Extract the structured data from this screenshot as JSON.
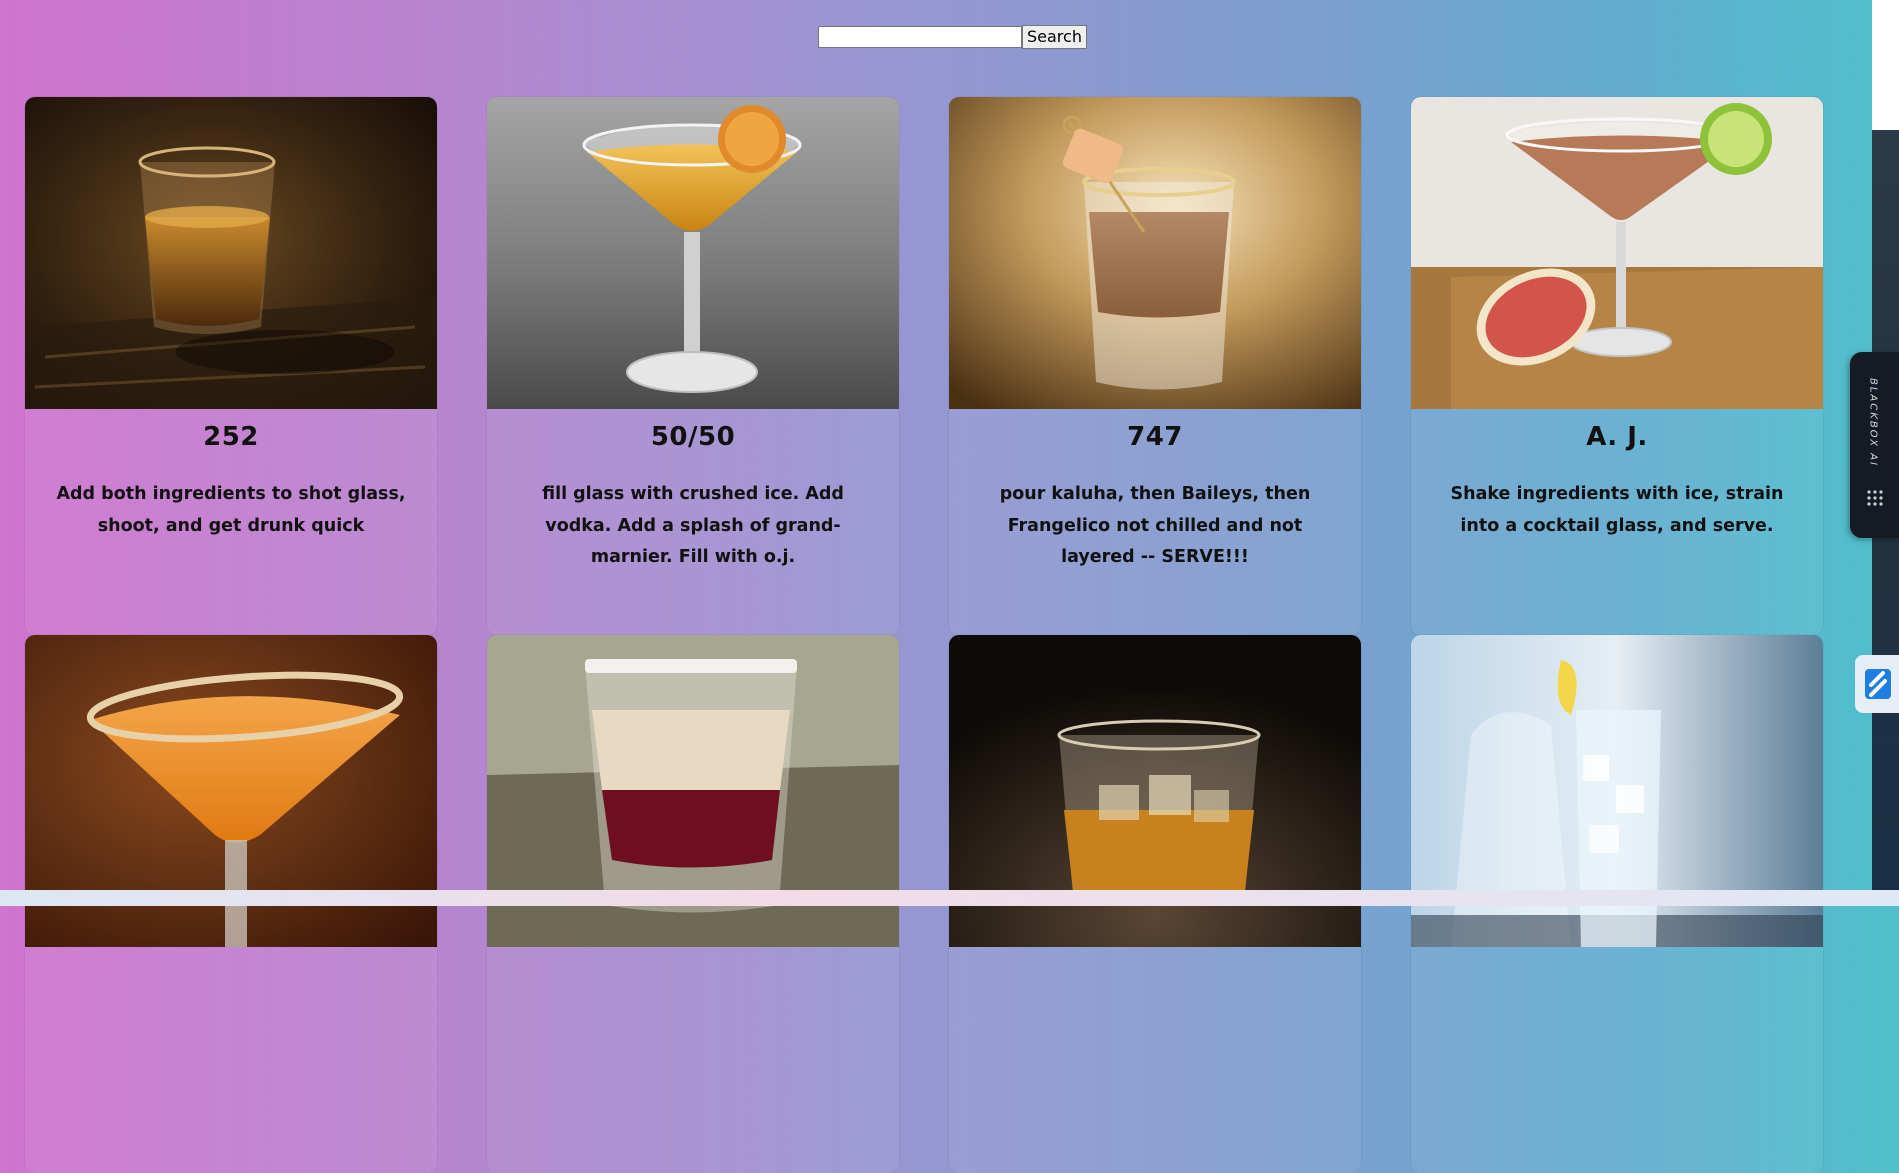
{
  "search": {
    "value": "",
    "placeholder": "",
    "button_label": "Search"
  },
  "cocktails": [
    {
      "name": "252",
      "description": "Add both ingredients to shot glass, shoot, and get drunk quick"
    },
    {
      "name": "50/50",
      "description": "fill glass with crushed ice. Add vodka. Add a splash of grand-marnier. Fill with o.j."
    },
    {
      "name": "747",
      "description": "pour kaluha, then Baileys, then Frangelico not chilled and not layered -- SERVE!!!"
    },
    {
      "name": "A. J.",
      "description": "Shake ingredients with ice, strain into a cocktail glass, and serve."
    },
    {
      "name": "",
      "description": ""
    },
    {
      "name": "",
      "description": ""
    },
    {
      "name": "",
      "description": ""
    },
    {
      "name": "",
      "description": ""
    }
  ],
  "extension": {
    "label": "BLACKBOX AI"
  },
  "icons": {
    "blackbox": "blackbox-logo-icon",
    "side": "lightning-icon"
  }
}
